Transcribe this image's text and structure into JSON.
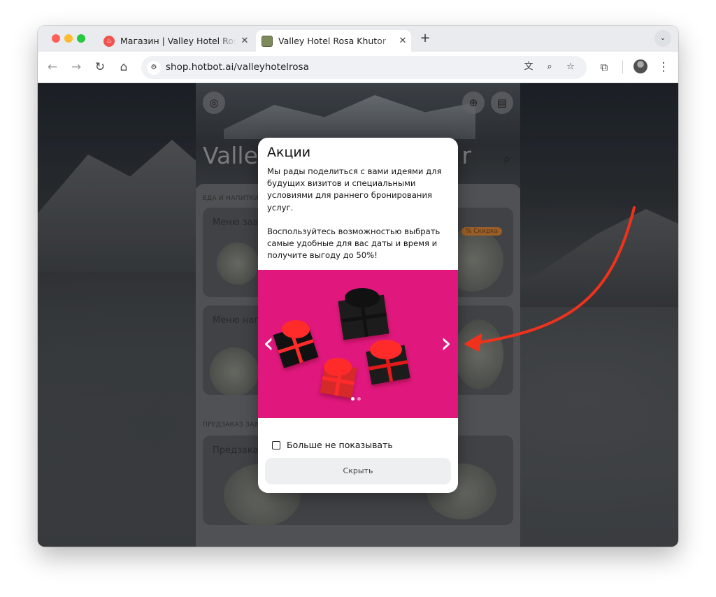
{
  "browser": {
    "tabs": [
      {
        "title": "Магазин | Valley Hotel Rosa Khutor",
        "active": false
      },
      {
        "title": "Valley Hotel Rosa Khutor",
        "active": true
      }
    ],
    "new_tab": "+",
    "url": "shop.hotbot.ai/valleyhotelrosa"
  },
  "page": {
    "title_left": "Valley",
    "title_right": "r",
    "sections": [
      {
        "label": "ЕДА И НАПИТКИ",
        "cards": [
          "Меню зав",
          "Меню нап"
        ]
      },
      {
        "label": "ПРЕДЗАКАЗ ЗАВ",
        "cards": [
          "Предзака"
        ]
      }
    ],
    "discount_badge": "% Скидка"
  },
  "modal": {
    "title": "Акции",
    "paragraph1": "Мы рады поделиться с вами идеями для будущих визитов и специальными условиями для раннего бронирования услуг.",
    "paragraph2": "Воспользуйтесь возможностью выбрать самые удобные для вас даты и время и получите выгоду до 50%!",
    "checkbox_label": "Больше не показывать",
    "hide_button": "Скрыть",
    "slide_count": 2,
    "active_slide": 1
  },
  "colors": {
    "slide_background": "#e0187d",
    "annotation_arrow": "#f0321c"
  },
  "icons": {
    "account": "account-circle-icon",
    "language": "globe-icon",
    "chat": "chat-icon",
    "search": "search-icon"
  }
}
